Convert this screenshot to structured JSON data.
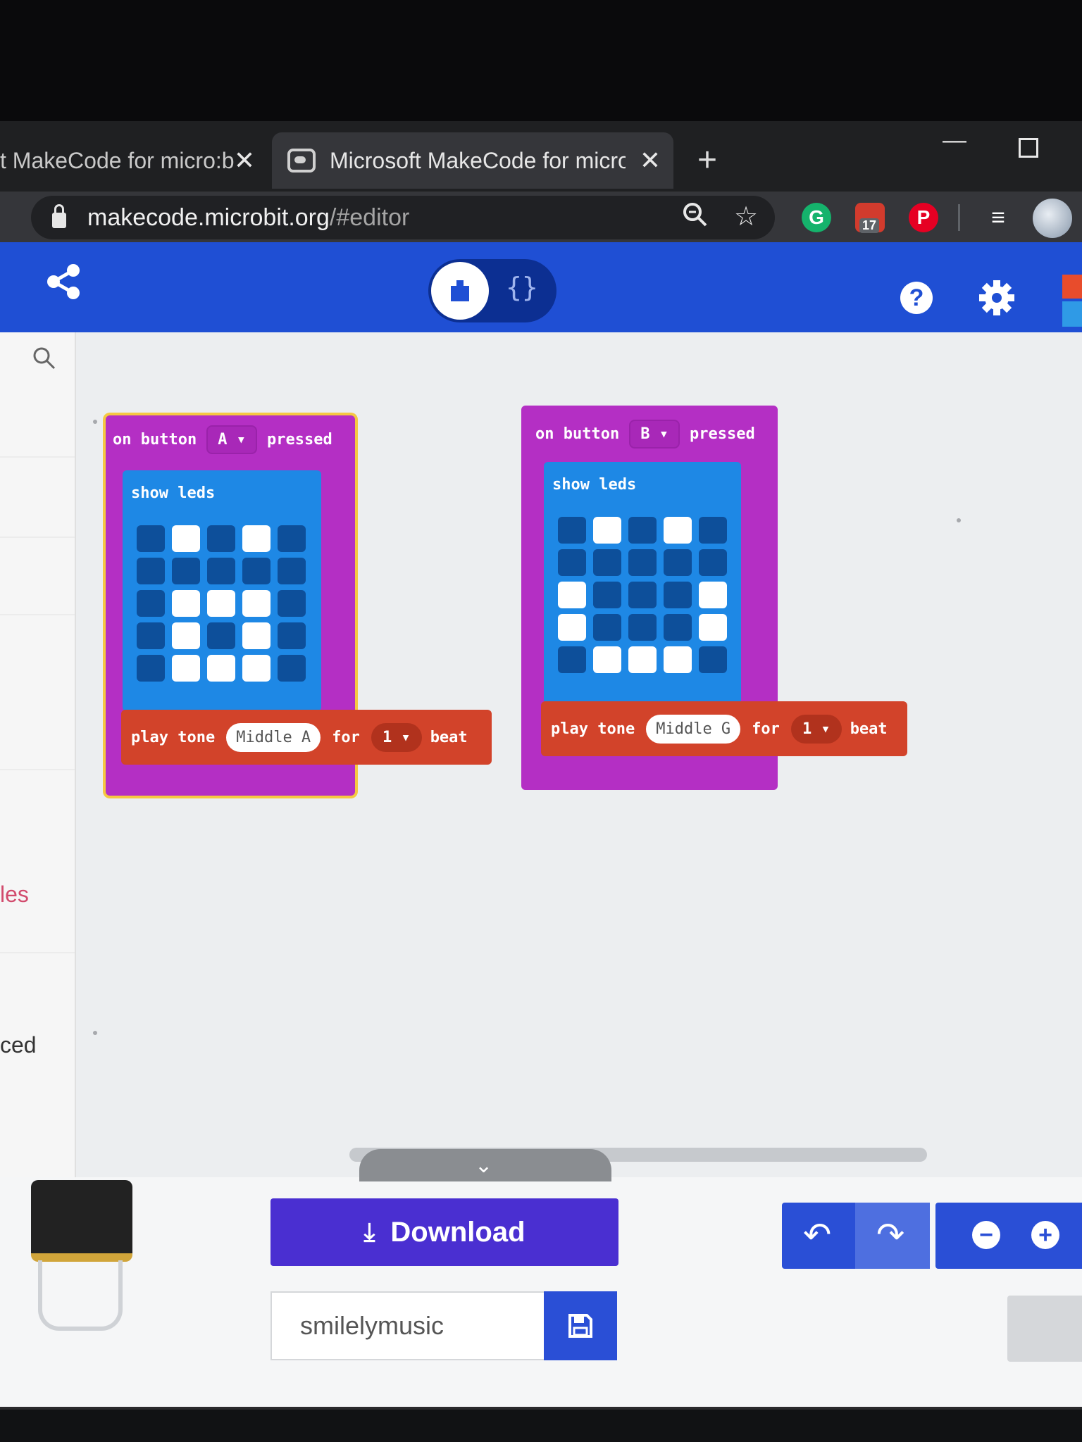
{
  "browser": {
    "tabs": [
      {
        "title": "t MakeCode for micro:b",
        "active": false
      },
      {
        "title": "Microsoft MakeCode for micro:b",
        "active": true
      }
    ],
    "tab_close_glyph": "✕",
    "new_tab_glyph": "+",
    "url_host": "makecode.microbit.org",
    "url_path": "/#editor",
    "extension_badge": "17"
  },
  "header": {
    "icons": [
      "share-icon",
      "blocks-mode-icon",
      "javascript-mode-icon",
      "help-icon",
      "gear-icon"
    ],
    "js_label": "{}",
    "help_glyph": "?"
  },
  "toolbox": {
    "partial_labels": [
      "les",
      "ced"
    ]
  },
  "blocks": [
    {
      "event_prefix": "on button",
      "button": "A ▾",
      "event_suffix": "pressed",
      "leds_label": "show leds",
      "leds": [
        [
          0,
          1,
          0,
          1,
          0
        ],
        [
          0,
          0,
          0,
          0,
          0
        ],
        [
          0,
          1,
          1,
          1,
          0
        ],
        [
          0,
          1,
          0,
          1,
          0
        ],
        [
          0,
          1,
          1,
          1,
          0
        ]
      ],
      "tone_label": "play tone",
      "note": "Middle A",
      "for_label": "for",
      "beats": "1 ▾",
      "beat_label": "beat"
    },
    {
      "event_prefix": "on button",
      "button": "B ▾",
      "event_suffix": "pressed",
      "leds_label": "show leds",
      "leds": [
        [
          0,
          1,
          0,
          1,
          0
        ],
        [
          0,
          0,
          0,
          0,
          0
        ],
        [
          1,
          0,
          0,
          0,
          1
        ],
        [
          1,
          0,
          0,
          0,
          1
        ],
        [
          0,
          1,
          1,
          1,
          0
        ]
      ],
      "tone_label": "play tone",
      "note": "Middle G",
      "for_label": "for",
      "beats": "1 ▾",
      "beat_label": "beat"
    }
  ],
  "footer": {
    "download_label": "Download",
    "project_name": "smilelymusic",
    "undo_glyph": "↶",
    "redo_glyph": "↷",
    "zoom_out_glyph": "−",
    "zoom_in_glyph": "+"
  },
  "colors": {
    "header_blue": "#1f4fd4",
    "event_purple": "#b42fc4",
    "leds_blue": "#1e88e5",
    "music_red": "#d2432a",
    "download_purple": "#4a2fd1"
  }
}
